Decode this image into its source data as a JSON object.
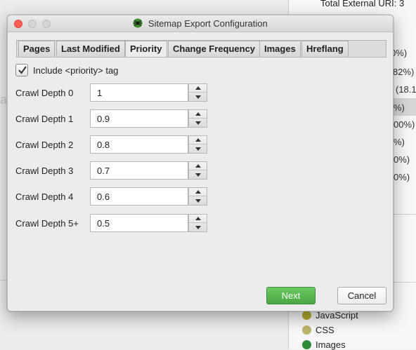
{
  "background": {
    "top_text": "Total External URI: 3",
    "percent_fragments": [
      "0%)",
      "82%)",
      "(18.1",
      "%)",
      "00%)",
      "%)",
      "0%)",
      "0%)"
    ],
    "legend": [
      {
        "label": "JavaScript",
        "color": "#b3ab2b"
      },
      {
        "label": "CSS",
        "color": "#beb66c"
      },
      {
        "label": "Images",
        "color": "#2e8b3a"
      }
    ],
    "left_fragment": "a"
  },
  "dialog": {
    "title": "Sitemap Export Configuration",
    "tabs": [
      {
        "label": "Pages",
        "active": false
      },
      {
        "label": "Last Modified",
        "active": false
      },
      {
        "label": "Priority",
        "active": true
      },
      {
        "label": "Change Frequency",
        "active": false
      },
      {
        "label": "Images",
        "active": false
      },
      {
        "label": "Hreflang",
        "active": false
      }
    ],
    "include_priority": {
      "label": "Include <priority> tag",
      "checked": true
    },
    "crawl_depths": [
      {
        "label": "Crawl Depth 0",
        "value": "1"
      },
      {
        "label": "Crawl Depth 1",
        "value": "0.9"
      },
      {
        "label": "Crawl Depth 2",
        "value": "0.8"
      },
      {
        "label": "Crawl Depth 3",
        "value": "0.7"
      },
      {
        "label": "Crawl Depth 4",
        "value": "0.6"
      },
      {
        "label": "Crawl Depth 5+",
        "value": "0.5"
      }
    ],
    "buttons": {
      "next": "Next",
      "cancel": "Cancel"
    },
    "colors": {
      "accent_green": "#5cb853",
      "close_red": "#fd5f57"
    }
  }
}
